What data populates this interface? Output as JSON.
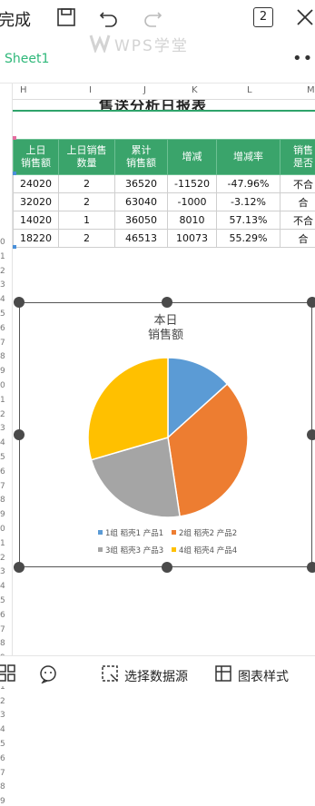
{
  "toolbar": {
    "done_label": "完成",
    "page_count": "2"
  },
  "watermark": "WPS学堂",
  "sheet_tab": "Sheet1",
  "more_label": "•••",
  "columns": [
    "H",
    "I",
    "J",
    "K",
    "L",
    "M"
  ],
  "row_labels": [
    "0",
    "1",
    "2",
    "3",
    "4",
    "5",
    "6",
    "7",
    "8",
    "9",
    "0",
    "1",
    "2",
    "3",
    "4",
    "5",
    "6",
    "7",
    "8",
    "9",
    "0",
    "1",
    "2",
    "3",
    "4",
    "5",
    "6",
    "7",
    "8",
    "9",
    "0",
    "1",
    "2",
    "3",
    "4",
    "5",
    "6",
    "7",
    "8",
    "9"
  ],
  "report_title_fragment": "售送分析日报表",
  "table": {
    "headers": [
      "上日\n销售额",
      "上日销售\n数量",
      "累计\n销售额",
      "增减",
      "增减率",
      "销售\n是否"
    ],
    "rows": [
      [
        "24020",
        "2",
        "36520",
        "-11520",
        "-47.96%",
        "不合"
      ],
      [
        "32020",
        "2",
        "63040",
        "-1000",
        "-3.12%",
        "合"
      ],
      [
        "14020",
        "1",
        "36050",
        "8010",
        "57.13%",
        "不合"
      ],
      [
        "18220",
        "2",
        "46513",
        "10073",
        "55.29%",
        "合"
      ]
    ]
  },
  "chart_data": {
    "type": "pie",
    "title": "本日\n销售额",
    "categories": [
      "1组 稻壳1 产品1",
      "2组 稻壳2 产品2",
      "3组 稻壳3 产品3",
      "4组 稻壳4 产品4"
    ],
    "values": [
      14,
      36,
      24,
      31
    ],
    "colors": [
      "#5b9bd5",
      "#ed7d31",
      "#a5a5a5",
      "#ffc000"
    ],
    "legend_position": "bottom"
  },
  "bottombar": {
    "select_data_label": "选择数据源",
    "chart_style_label": "图表样式"
  }
}
